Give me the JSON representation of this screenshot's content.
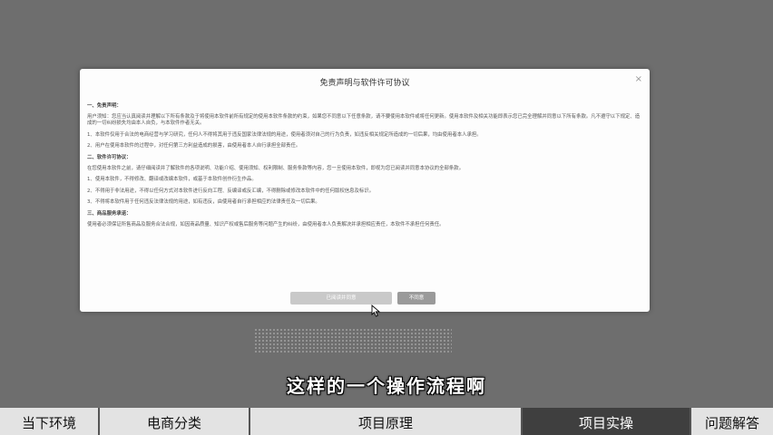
{
  "dialog": {
    "title": "免责声明与软件许可协议",
    "close": "×",
    "sections": [
      {
        "heading": "一、免责声明：",
        "paragraphs": [
          "用户须知：您应当认真阅读并理解以下所有条款及于将使用本软件前所有规定的使用本软件条款的约束，如果您不同意以下任意条款，请不要使用本软件或将任何更新。使用本软件及相关功能即表示您已完全理解并同意以下所有条款。凡不遵守以下规定、造成的一切纠纷损失均由本人自负，与本软件作者无关。",
          "1、本软件仅用于合法的电商经营与学习研究，任何人不得将其用于违反国家法律法规的用途，使用者须对自己的行为负责，如违反相关规定所造成的一切后果，均由使用者本人承担。",
          "2、用户在使用本软件的过程中，对任何第三方利益造成的损害，由使用者本人自行承担全部责任。"
        ]
      },
      {
        "heading": "二、软件许可协议：",
        "paragraphs": [
          "在您使用本软件之前，请仔细阅读并了解软件的各项说明、功能介绍、使用须知、权利限制、服务条款等内容，您一旦使用本软件，即视为您已阅读并同意本协议的全部条款。",
          "1、使用本软件，不得修改、翻译或改编本软件，或基于本软件创作衍生作品。",
          "2、不得用于非法用途，不得以任何方式对本软件进行反向工程、反编译或反汇编，不得删除或修改本软件中的任何版权信息及标识。",
          "3、不得将本软件用于任何违反法律法规的用途，如有违反，由使用者自行承担相应的法律责任及一切后果。"
        ]
      },
      {
        "heading": "三、商品服务承诺：",
        "paragraphs": [
          "使用者必须保证所售商品及服务合法合规，如因商品质量、知识产权或售后服务等问题产生的纠纷，由使用者本人负责解决并承担相应责任，本软件不承担任何责任。"
        ]
      }
    ],
    "accept_label": "已阅读并同意",
    "decline_label": "不同意"
  },
  "subtitle": "这样的一个操作流程啊",
  "watermark": "",
  "nav": {
    "items": [
      {
        "label": "当下环境",
        "active": false
      },
      {
        "label": "电商分类",
        "active": false
      },
      {
        "label": "项目原理",
        "active": false
      },
      {
        "label": "项目实操",
        "active": true
      },
      {
        "label": "问题解答",
        "active": false
      }
    ]
  },
  "colors": {
    "backdrop": "#6e6e6e",
    "nav_bg": "#e3e3e3",
    "nav_active": "#3f3f3f"
  },
  "icons": [
    "close-icon",
    "mouse-pointer-icon"
  ]
}
